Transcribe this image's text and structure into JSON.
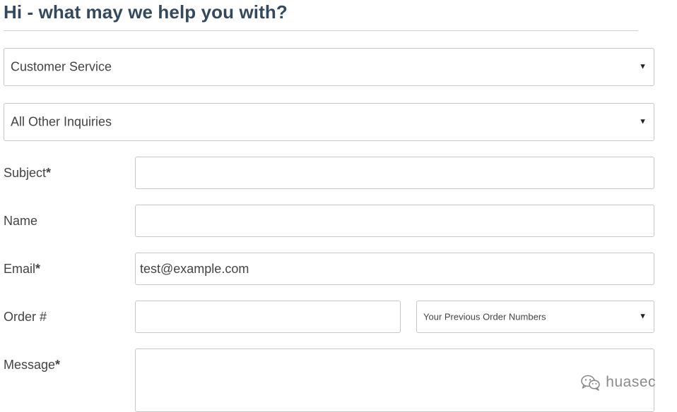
{
  "header": {
    "title": "Hi - what may we help you with?"
  },
  "department_select": {
    "selected": "Customer Service"
  },
  "inquiry_select": {
    "selected": "All Other Inquiries"
  },
  "form": {
    "subject": {
      "label": "Subject",
      "required_mark": "*",
      "value": ""
    },
    "name": {
      "label": "Name",
      "value": ""
    },
    "email": {
      "label": "Email",
      "required_mark": "*",
      "value": "test@example.com"
    },
    "order": {
      "label": "Order #",
      "value": "",
      "previous_orders_selected": "Your Previous Order Numbers"
    },
    "message": {
      "label": "Message",
      "required_mark": "*",
      "value": ""
    }
  },
  "icons": {
    "caret": "caret-down-icon",
    "watermark": "wechat-icon"
  },
  "watermark": {
    "text": "huasec"
  },
  "colors": {
    "title": "#34495e",
    "border": "#c8c8c8",
    "text": "#444444"
  }
}
